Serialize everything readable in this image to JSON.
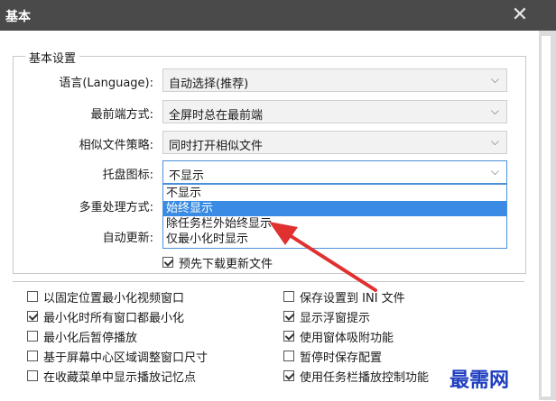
{
  "window": {
    "title": "基本"
  },
  "group": {
    "legend": "基本设置",
    "rows": [
      {
        "label": "语言(Language):",
        "value": "自动选择(推荐)"
      },
      {
        "label": "最前端方式:",
        "value": "全屏时总在最前端"
      },
      {
        "label": "相似文件策略:",
        "value": "同时打开相似文件"
      },
      {
        "label": "托盘图标:",
        "value": "不显示"
      }
    ],
    "extra_labels": {
      "multi": "多重处理方式:",
      "auto_update": "自动更新:"
    },
    "dropdown_options": [
      "不显示",
      "始终显示",
      "除任务栏外始终显示",
      "仅最小化时显示"
    ],
    "selected_option_index": 1,
    "predownload": {
      "label": "预先下载更新文件",
      "checked": true
    }
  },
  "options_left": [
    {
      "label": "以固定位置最小化视频窗口",
      "checked": false
    },
    {
      "label": "最小化时所有窗口都最小化",
      "checked": true
    },
    {
      "label": "最小化后暂停播放",
      "checked": false
    },
    {
      "label": "基于屏幕中心区域调整窗口尺寸",
      "checked": false
    },
    {
      "label": "在收藏菜单中显示播放记忆点",
      "checked": false
    }
  ],
  "options_right": [
    {
      "label": "保存设置到 INI 文件",
      "checked": false
    },
    {
      "label": "显示浮窗提示",
      "checked": true
    },
    {
      "label": "使用窗体吸附功能",
      "checked": true
    },
    {
      "label": "暂停时保存配置",
      "checked": false
    },
    {
      "label": "使用任务栏播放控制功能",
      "checked": true
    }
  ],
  "watermark": "最需网",
  "colors": {
    "accent": "#3a8be3",
    "arrow": "#e03030",
    "titlebar": "#4a4a4a",
    "watermark": "#1f3fbf"
  }
}
